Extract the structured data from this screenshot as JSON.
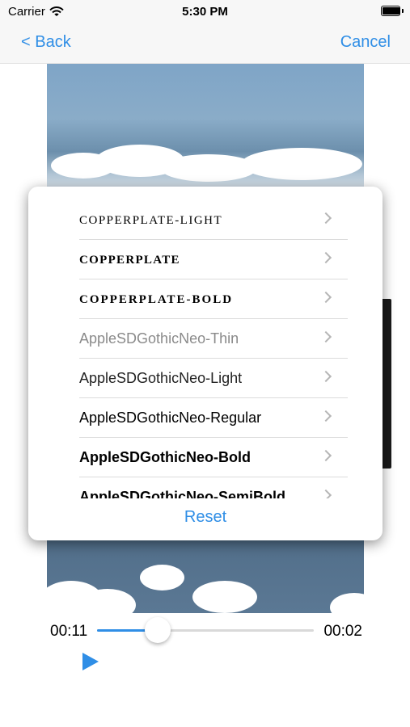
{
  "status_bar": {
    "carrier": "Carrier",
    "time": "5:30 PM",
    "battery_level": 0.95
  },
  "nav": {
    "back_label": "< Back",
    "cancel_label": "Cancel"
  },
  "font_list": {
    "items": [
      {
        "label": "Copperplate-Light"
      },
      {
        "label": "Copperplate"
      },
      {
        "label": "Copperplate-Bold"
      },
      {
        "label": "AppleSDGothicNeo-Thin"
      },
      {
        "label": "AppleSDGothicNeo-Light"
      },
      {
        "label": "AppleSDGothicNeo-Regular"
      },
      {
        "label": "AppleSDGothicNeo-Bold"
      },
      {
        "label": "AppleSDGothicNeo-SemiBold"
      }
    ],
    "reset_label": "Reset"
  },
  "player": {
    "current_time": "00:11",
    "remaining_time": "00:02",
    "progress": 0.28
  },
  "colors": {
    "accent": "#2f8ee6",
    "divider": "#dcdcdc",
    "nav_background": "#f7f7f7"
  }
}
